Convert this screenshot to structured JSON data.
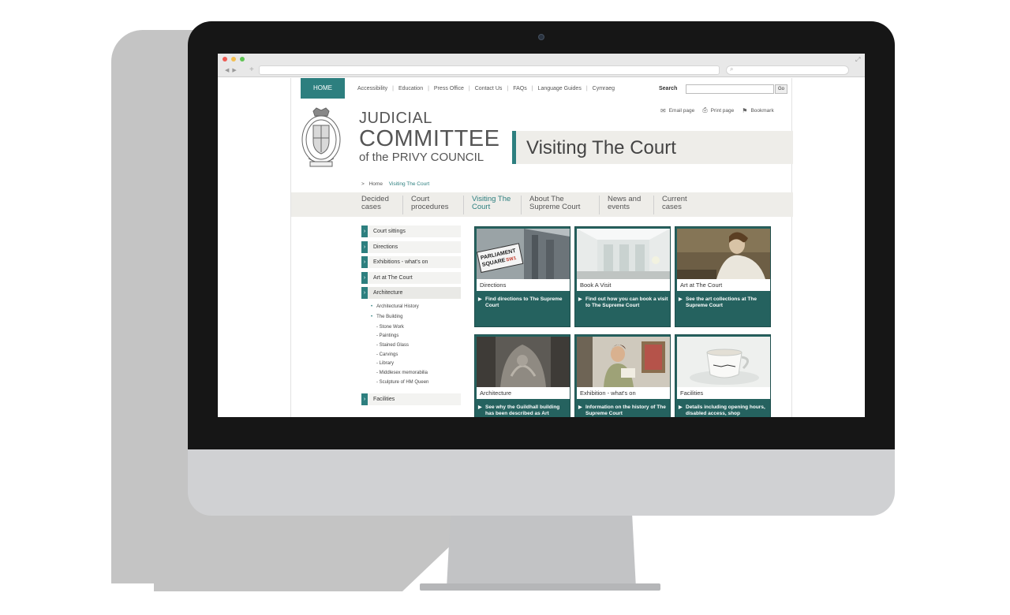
{
  "site": {
    "home_label": "HOME",
    "top_links": [
      "Accessibility",
      "Education",
      "Press Office",
      "Contact Us",
      "FAQs",
      "Language Guides",
      "Cymraeg"
    ],
    "search_label": "Search",
    "search_button": "Go",
    "tools": [
      {
        "icon": "email-icon",
        "label": "Email page"
      },
      {
        "icon": "print-icon",
        "label": "Print page"
      },
      {
        "icon": "bookmark-icon",
        "label": "Bookmark"
      }
    ],
    "logo": {
      "line1": "JUDICIAL",
      "line2": "COMMITTEE",
      "line3": "of the PRIVY COUNCIL"
    },
    "page_title": "Visiting The Court",
    "breadcrumb": {
      "arrow": ">",
      "home": "Home",
      "current": "Visiting The Court"
    },
    "colors": {
      "accent": "#2d7f7f",
      "tile_bg": "#25625f",
      "band": "#eeede9"
    }
  },
  "main_nav": [
    {
      "line1": "Decided",
      "line2": "cases"
    },
    {
      "line1": "Court",
      "line2": "procedures"
    },
    {
      "line1": "Visiting The",
      "line2": "Court"
    },
    {
      "line1": "About The",
      "line2": "Supreme Court"
    },
    {
      "line1": "News and",
      "line2": "events"
    },
    {
      "line1": "Current",
      "line2": "cases"
    }
  ],
  "sidebar": {
    "items": [
      "Court sittings",
      "Directions",
      "Exhibitions - what's on",
      "Art at The Court",
      "Architecture"
    ],
    "sub_items": [
      "Architectural History",
      "The Building"
    ],
    "sub_sub_items": [
      "- Stone Work",
      "- Paintings",
      "- Stained Glass",
      "- Carvings",
      "- Library",
      "- Middlesex memorabilia",
      "- Sculpture of HM Queen"
    ],
    "last_item": "Facilities"
  },
  "tiles": [
    {
      "caption": "Directions",
      "description": "Find directions to The Supreme Court"
    },
    {
      "caption": "Book A Visit",
      "description": "Find out how you can book a visit to The Supreme Court"
    },
    {
      "caption": "Art at The Court",
      "description": "See the art collections at The Supreme Court"
    },
    {
      "caption": "Architecture",
      "description": "See why the Guildhall building has been described as Art"
    },
    {
      "caption": "Exhibition - what's on",
      "description": "Information on the history of The Supreme Court"
    },
    {
      "caption": "Facilities",
      "description": "Details including opening hours, disabled access, shop"
    }
  ],
  "sign_text": {
    "line1": "PARLIAMENT",
    "line2": "SQUARE",
    "code": "SW1"
  }
}
